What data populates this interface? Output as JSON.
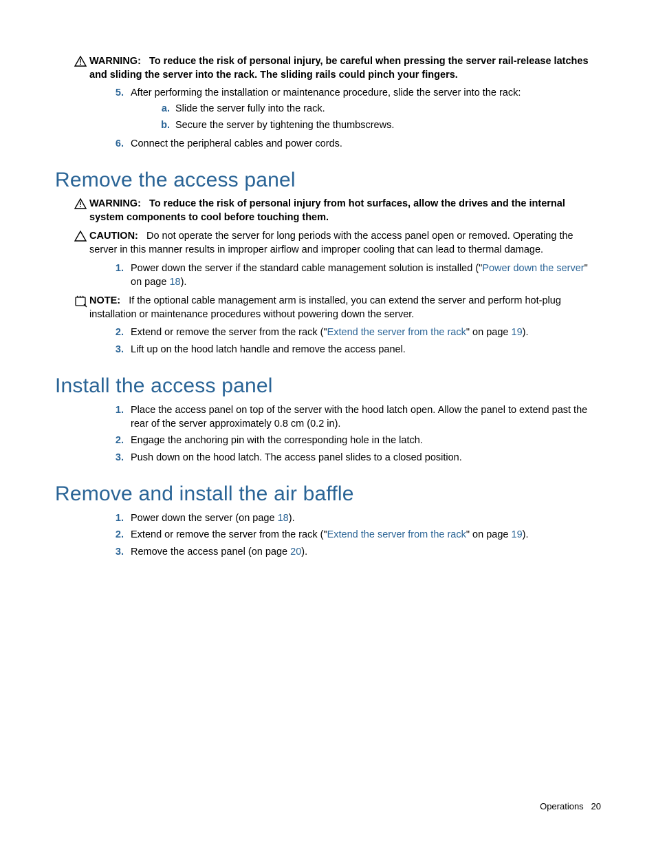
{
  "admon1": {
    "label": "WARNING:",
    "text": "To reduce the risk of personal injury, be careful when pressing the server rail-release latches and sliding the server into the rack. The sliding rails could pinch your fingers."
  },
  "list1": {
    "i5": {
      "marker": "5.",
      "text": "After performing the installation or maintenance procedure, slide the server into the rack:"
    },
    "i5a": {
      "marker": "a.",
      "text": "Slide the server fully into the rack."
    },
    "i5b": {
      "marker": "b.",
      "text": "Secure the server by tightening the thumbscrews."
    },
    "i6": {
      "marker": "6.",
      "text": "Connect the peripheral cables and power cords."
    }
  },
  "h_remove": "Remove the access panel",
  "admon2": {
    "label": "WARNING:",
    "text": "To reduce the risk of personal injury from hot surfaces, allow the drives and the internal system components to cool before touching them."
  },
  "admon3": {
    "label": "CAUTION:",
    "text": "Do not operate the server for long periods with the access panel open or removed. Operating the server in this manner results in improper airflow and improper cooling that can lead to thermal damage."
  },
  "list2": {
    "i1": {
      "marker": "1.",
      "pre": "Power down the server if the standard cable management solution is installed (\"",
      "link": "Power down the server",
      "mid": "\" on page ",
      "page": "18",
      "post": ")."
    }
  },
  "admon4": {
    "label": "NOTE:",
    "text": "If the optional cable management arm is installed, you can extend the server and perform hot-plug installation or maintenance procedures without powering down the server."
  },
  "list3": {
    "i2": {
      "marker": "2.",
      "pre": "Extend or remove the server from the rack (\"",
      "link": "Extend the server from the rack",
      "mid": "\" on page ",
      "page": "19",
      "post": ")."
    },
    "i3": {
      "marker": "3.",
      "text": "Lift up on the hood latch handle and remove the access panel."
    }
  },
  "h_install": "Install the access panel",
  "list4": {
    "i1": {
      "marker": "1.",
      "text": "Place the access panel on top of the server with the hood latch open. Allow the panel to extend past the rear of the server approximately 0.8 cm (0.2 in)."
    },
    "i2": {
      "marker": "2.",
      "text": "Engage the anchoring pin with the corresponding hole in the latch."
    },
    "i3": {
      "marker": "3.",
      "text": "Push down on the hood latch. The access panel slides to a closed position."
    }
  },
  "h_baffle": "Remove and install the air baffle",
  "list5": {
    "i1": {
      "marker": "1.",
      "pre": "Power down the server (on page ",
      "page": "18",
      "post": ")."
    },
    "i2": {
      "marker": "2.",
      "pre": "Extend or remove the server from the rack (\"",
      "link": "Extend the server from the rack",
      "mid": "\" on page ",
      "page": "19",
      "post": ")."
    },
    "i3": {
      "marker": "3.",
      "pre": "Remove the access panel (on page ",
      "page": "20",
      "post": ")."
    }
  },
  "footer": {
    "section": "Operations",
    "page": "20"
  }
}
